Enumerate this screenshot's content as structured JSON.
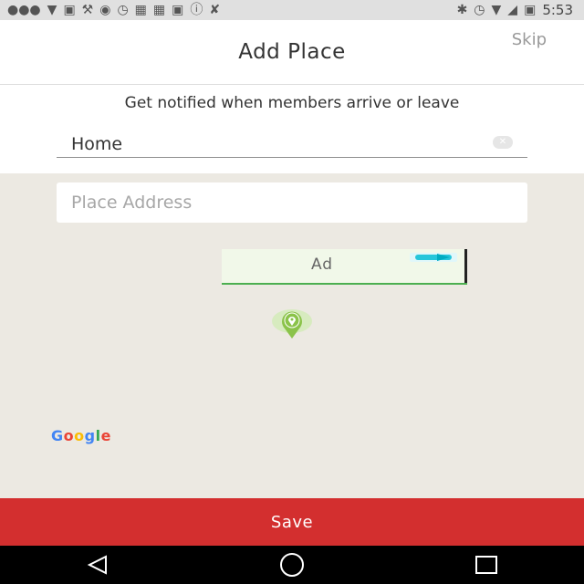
{
  "status_bar": {
    "time": "5:53",
    "left_icons": [
      "more-icon",
      "v-icon",
      "facebook-icon",
      "wrench-icon",
      "location-icon",
      "alarm-icon",
      "image-icon",
      "image-icon",
      "facebook-icon",
      "info-icon",
      "no-gps-icon"
    ],
    "right_icons": [
      "bluetooth-icon",
      "alarm-icon",
      "wifi-icon",
      "no-signal-icon",
      "battery-charging-icon"
    ]
  },
  "header": {
    "title": "Add Place",
    "skip_label": "Skip"
  },
  "form": {
    "subtitle": "Get notified when members arrive or leave",
    "name_value": "Home"
  },
  "map": {
    "address_placeholder": "Place Address",
    "ad_label": "Ad",
    "google_logo": {
      "letters": [
        "G",
        "o",
        "o",
        "g",
        "l",
        "e"
      ],
      "colors": [
        "#4285f4",
        "#ea4335",
        "#fbbc05",
        "#4285f4",
        "#34a853",
        "#ea4335"
      ]
    }
  },
  "save_label": "Save",
  "nav": [
    "back-icon",
    "home-icon",
    "recents-icon"
  ],
  "colors": {
    "accent_red": "#d32f2f",
    "pin_green": "#8bc34a",
    "map_bg": "#ece9e2"
  }
}
